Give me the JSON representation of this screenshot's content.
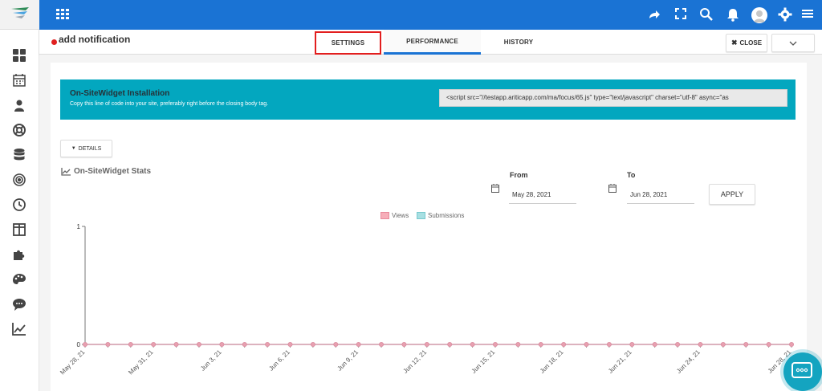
{
  "header": {
    "title": "add notification",
    "tabs": [
      {
        "label": "SETTINGS"
      },
      {
        "label": "PERFORMANCE"
      },
      {
        "label": "HISTORY"
      }
    ],
    "close_label": "CLOSE"
  },
  "banner": {
    "title": "On-SiteWidget Installation",
    "subtitle": "Copy this line of code into your site, preferably right before the closing body tag.",
    "code": "<script src=\"//testapp.ariticapp.com/ma/focus/65.js\" type=\"text/javascript\" charset=\"utf-8\" async=\"as"
  },
  "details_label": "DETAILS",
  "stats": {
    "title": "On-SiteWidget Stats",
    "from_label": "From",
    "from_value": "May 28, 2021",
    "to_label": "To",
    "to_value": "Jun 28, 2021",
    "apply_label": "APPLY"
  },
  "colors": {
    "topbar": "#1a73d4",
    "banner": "#03a7bf",
    "views": "#f6aeb9",
    "submissions": "#a7dfe2",
    "line": "#d98c9f"
  },
  "icons": {
    "topbar": [
      "apps-grid-icon",
      "share-icon",
      "fullscreen-icon",
      "search-icon",
      "bell-icon",
      "user-avatar-icon",
      "gear-icon",
      "menu-icon"
    ],
    "sidebar": [
      "dashboard-icon",
      "calendar-icon",
      "user-icon",
      "lifebuoy-icon",
      "database-icon",
      "target-icon",
      "clock-icon",
      "columns-icon",
      "puzzle-icon",
      "palette-icon",
      "chat-icon",
      "chart-line-icon"
    ]
  },
  "chart_data": {
    "type": "line",
    "legend": [
      "Views",
      "Submissions"
    ],
    "x": [
      "May 28, 21",
      "May 29, 21",
      "May 30, 21",
      "May 31, 21",
      "Jun 1, 21",
      "Jun 2, 21",
      "Jun 3, 21",
      "Jun 4, 21",
      "Jun 5, 21",
      "Jun 6, 21",
      "Jun 7, 21",
      "Jun 8, 21",
      "Jun 9, 21",
      "Jun 10, 21",
      "Jun 11, 21",
      "Jun 12, 21",
      "Jun 13, 21",
      "Jun 14, 21",
      "Jun 15, 21",
      "Jun 16, 21",
      "Jun 17, 21",
      "Jun 18, 21",
      "Jun 19, 21",
      "Jun 20, 21",
      "Jun 21, 21",
      "Jun 22, 21",
      "Jun 23, 21",
      "Jun 24, 21",
      "Jun 25, 21",
      "Jun 26, 21",
      "Jun 27, 21",
      "Jun 28, 21"
    ],
    "xtick_labels": [
      "May 28, 21",
      "May 31, 21",
      "Jun 3, 21",
      "Jun 6, 21",
      "Jun 9, 21",
      "Jun 12, 21",
      "Jun 15, 21",
      "Jun 18, 21",
      "Jun 21, 21",
      "Jun 24, 21",
      "Jun 28, 21"
    ],
    "series": [
      {
        "name": "Views",
        "values": [
          0,
          0,
          0,
          0,
          0,
          0,
          0,
          0,
          0,
          0,
          0,
          0,
          0,
          0,
          0,
          0,
          0,
          0,
          0,
          0,
          0,
          0,
          0,
          0,
          0,
          0,
          0,
          0,
          0,
          0,
          0,
          0
        ]
      },
      {
        "name": "Submissions",
        "values": [
          0,
          0,
          0,
          0,
          0,
          0,
          0,
          0,
          0,
          0,
          0,
          0,
          0,
          0,
          0,
          0,
          0,
          0,
          0,
          0,
          0,
          0,
          0,
          0,
          0,
          0,
          0,
          0,
          0,
          0,
          0,
          0
        ]
      }
    ],
    "yticks": [
      0,
      1
    ],
    "ylim": [
      0,
      1
    ],
    "legend_position": "top-center"
  }
}
